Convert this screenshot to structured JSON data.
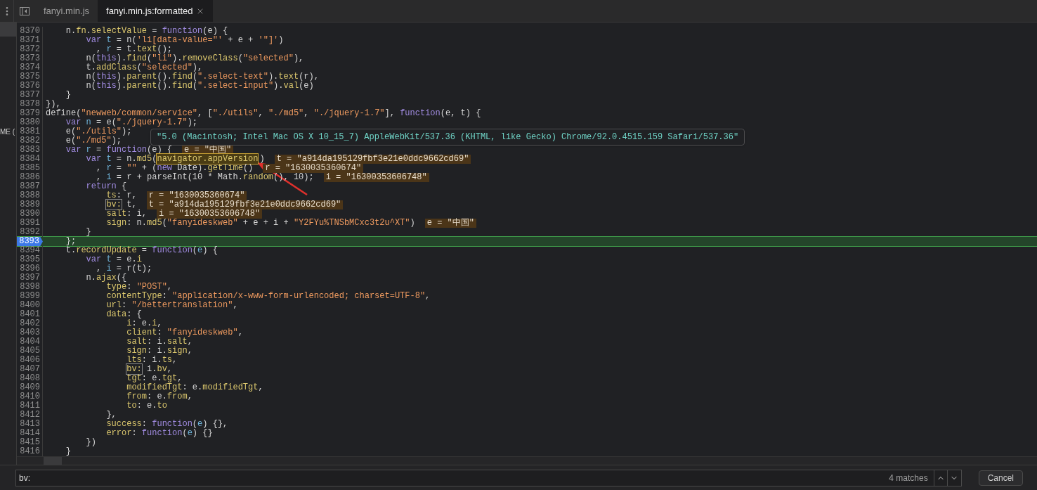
{
  "tabs": [
    {
      "label": "fanyi.min.js",
      "selected": false,
      "closable": false
    },
    {
      "label": "fanyi.min.js:formatted",
      "selected": true,
      "closable": true
    }
  ],
  "side_panel": {
    "text": "ME ("
  },
  "editor": {
    "tooltip": "\"5.0 (Macintosh; Intel Mac OS X 10_15_7) AppleWebKit/537.36 (KHTML, like Gecko) Chrome/92.0.4515.159 Safari/537.36\"",
    "lines": [
      {
        "number": "8370",
        "current": false,
        "tokens": [
          {
            "kind": "plain",
            "text": "    n."
          },
          {
            "kind": "property",
            "text": "fn"
          },
          {
            "kind": "plain",
            "text": "."
          },
          {
            "kind": "property",
            "text": "selectValue"
          },
          {
            "kind": "plain",
            "text": " = "
          },
          {
            "kind": "keyword",
            "text": "function"
          },
          {
            "kind": "plain",
            "text": "(e) {"
          }
        ]
      },
      {
        "number": "8371",
        "current": false,
        "tokens": [
          {
            "kind": "keyword",
            "text": "        var"
          },
          {
            "kind": "variable",
            "text": " t"
          },
          {
            "kind": "plain",
            "text": " = n("
          },
          {
            "kind": "string",
            "text": "'li[data-value=\"'"
          },
          {
            "kind": "plain",
            "text": " + e + "
          },
          {
            "kind": "string",
            "text": "'\"]'"
          },
          {
            "kind": "plain",
            "text": ")"
          }
        ]
      },
      {
        "number": "8372",
        "current": false,
        "tokens": [
          {
            "kind": "plain",
            "text": "          , "
          },
          {
            "kind": "variable",
            "text": "r"
          },
          {
            "kind": "plain",
            "text": " = t."
          },
          {
            "kind": "property",
            "text": "text"
          },
          {
            "kind": "plain",
            "text": "();"
          }
        ]
      },
      {
        "number": "8373",
        "current": false,
        "tokens": [
          {
            "kind": "plain",
            "text": "        n("
          },
          {
            "kind": "keyword",
            "text": "this"
          },
          {
            "kind": "plain",
            "text": ")."
          },
          {
            "kind": "property",
            "text": "find"
          },
          {
            "kind": "plain",
            "text": "("
          },
          {
            "kind": "string",
            "text": "\"li\""
          },
          {
            "kind": "plain",
            "text": ")."
          },
          {
            "kind": "property",
            "text": "removeClass"
          },
          {
            "kind": "plain",
            "text": "("
          },
          {
            "kind": "string",
            "text": "\"selected\""
          },
          {
            "kind": "plain",
            "text": "),"
          }
        ]
      },
      {
        "number": "8374",
        "current": false,
        "tokens": [
          {
            "kind": "plain",
            "text": "        t."
          },
          {
            "kind": "property",
            "text": "addClass"
          },
          {
            "kind": "plain",
            "text": "("
          },
          {
            "kind": "string",
            "text": "\"selected\""
          },
          {
            "kind": "plain",
            "text": "),"
          }
        ]
      },
      {
        "number": "8375",
        "current": false,
        "tokens": [
          {
            "kind": "plain",
            "text": "        n("
          },
          {
            "kind": "keyword",
            "text": "this"
          },
          {
            "kind": "plain",
            "text": ")."
          },
          {
            "kind": "property",
            "text": "parent"
          },
          {
            "kind": "plain",
            "text": "()."
          },
          {
            "kind": "property",
            "text": "find"
          },
          {
            "kind": "plain",
            "text": "("
          },
          {
            "kind": "string",
            "text": "\".select-text\""
          },
          {
            "kind": "plain",
            "text": ")."
          },
          {
            "kind": "property",
            "text": "text"
          },
          {
            "kind": "plain",
            "text": "(r),"
          }
        ]
      },
      {
        "number": "8376",
        "current": false,
        "tokens": [
          {
            "kind": "plain",
            "text": "        n("
          },
          {
            "kind": "keyword",
            "text": "this"
          },
          {
            "kind": "plain",
            "text": ")."
          },
          {
            "kind": "property",
            "text": "parent"
          },
          {
            "kind": "plain",
            "text": "()."
          },
          {
            "kind": "property",
            "text": "find"
          },
          {
            "kind": "plain",
            "text": "("
          },
          {
            "kind": "string",
            "text": "\".select-input\""
          },
          {
            "kind": "plain",
            "text": ")."
          },
          {
            "kind": "property",
            "text": "val"
          },
          {
            "kind": "plain",
            "text": "(e)"
          }
        ]
      },
      {
        "number": "8377",
        "current": false,
        "tokens": [
          {
            "kind": "plain",
            "text": "    }"
          }
        ]
      },
      {
        "number": "8378",
        "current": false,
        "tokens": [
          {
            "kind": "plain",
            "text": "}),"
          }
        ]
      },
      {
        "number": "8379",
        "current": false,
        "tokens": [
          {
            "kind": "plain",
            "text": "define("
          },
          {
            "kind": "string",
            "text": "\"newweb/common/service\""
          },
          {
            "kind": "plain",
            "text": ", ["
          },
          {
            "kind": "string",
            "text": "\"./utils\""
          },
          {
            "kind": "plain",
            "text": ", "
          },
          {
            "kind": "string",
            "text": "\"./md5\""
          },
          {
            "kind": "plain",
            "text": ", "
          },
          {
            "kind": "string",
            "text": "\"./jquery-1.7\""
          },
          {
            "kind": "plain",
            "text": "], "
          },
          {
            "kind": "keyword",
            "text": "function"
          },
          {
            "kind": "plain",
            "text": "(e, t) {"
          }
        ]
      },
      {
        "number": "8380",
        "current": false,
        "tokens": [
          {
            "kind": "keyword",
            "text": "    var"
          },
          {
            "kind": "variable",
            "text": " n"
          },
          {
            "kind": "plain",
            "text": " = e("
          },
          {
            "kind": "string",
            "text": "\"./jquery-1.7\""
          },
          {
            "kind": "plain",
            "text": ");"
          }
        ]
      },
      {
        "number": "8381",
        "current": false,
        "tokens": [
          {
            "kind": "plain",
            "text": "    e("
          },
          {
            "kind": "string",
            "text": "\"./utils\""
          },
          {
            "kind": "plain",
            "text": ");"
          }
        ]
      },
      {
        "number": "8382",
        "current": false,
        "tokens": [
          {
            "kind": "plain",
            "text": "    e("
          },
          {
            "kind": "string",
            "text": "\"./md5\""
          },
          {
            "kind": "plain",
            "text": ");"
          }
        ]
      },
      {
        "number": "8383",
        "current": false,
        "tokens": [
          {
            "kind": "keyword",
            "text": "    var"
          },
          {
            "kind": "variable",
            "text": " r"
          },
          {
            "kind": "plain",
            "text": " = "
          },
          {
            "kind": "keyword",
            "text": "function"
          },
          {
            "kind": "plain",
            "text": "(e) {"
          }
        ],
        "value": "e = \"中国\""
      },
      {
        "number": "8384",
        "current": false,
        "tokens": [
          {
            "kind": "keyword",
            "text": "        var"
          },
          {
            "kind": "variable",
            "text": " t"
          },
          {
            "kind": "plain",
            "text": " = n."
          },
          {
            "kind": "property",
            "text": "md5"
          },
          {
            "kind": "plain",
            "text": "("
          },
          {
            "kind": "highlight",
            "text": "navigator.appVersion"
          },
          {
            "kind": "plain",
            "text": ")"
          }
        ],
        "value": "t = \"a914da195129fbf3e21e0ddc9662cd69\""
      },
      {
        "number": "8385",
        "current": false,
        "tokens": [
          {
            "kind": "plain",
            "text": "          , "
          },
          {
            "kind": "variable",
            "text": "r"
          },
          {
            "kind": "plain",
            "text": " = "
          },
          {
            "kind": "string",
            "text": "\"\""
          },
          {
            "kind": "plain",
            "text": " + ("
          },
          {
            "kind": "keyword",
            "text": "new"
          },
          {
            "kind": "plain",
            "text": " Date)."
          },
          {
            "kind": "property",
            "text": "getTime"
          },
          {
            "kind": "plain",
            "text": "()"
          }
        ],
        "value": "r = \"1630035360674\""
      },
      {
        "number": "8386",
        "current": false,
        "tokens": [
          {
            "kind": "plain",
            "text": "          , "
          },
          {
            "kind": "variable",
            "text": "i"
          },
          {
            "kind": "plain",
            "text": " = r + parseInt(10 * Math."
          },
          {
            "kind": "property",
            "text": "random"
          },
          {
            "kind": "plain",
            "text": "(), 10);"
          }
        ],
        "value": "i = \"16300353606748\""
      },
      {
        "number": "8387",
        "current": false,
        "tokens": [
          {
            "kind": "keyword",
            "text": "        return"
          },
          {
            "kind": "plain",
            "text": " {"
          }
        ]
      },
      {
        "number": "8388",
        "current": false,
        "tokens": [
          {
            "kind": "property",
            "text": "            ts"
          },
          {
            "kind": "plain",
            "text": ": r,"
          }
        ],
        "value": "r = \"1630035360674\""
      },
      {
        "number": "8389",
        "current": false,
        "tokens": [
          {
            "kind": "boxed",
            "text": "            bv:"
          },
          {
            "kind": "plain",
            "text": " t,"
          }
        ],
        "value": "t = \"a914da195129fbf3e21e0ddc9662cd69\""
      },
      {
        "number": "8390",
        "current": false,
        "tokens": [
          {
            "kind": "property",
            "text": "            salt"
          },
          {
            "kind": "plain",
            "text": ": i,"
          }
        ],
        "value": "i = \"16300353606748\""
      },
      {
        "number": "8391",
        "current": false,
        "tokens": [
          {
            "kind": "property",
            "text": "            sign"
          },
          {
            "kind": "plain",
            "text": ": n."
          },
          {
            "kind": "property",
            "text": "md5"
          },
          {
            "kind": "plain",
            "text": "("
          },
          {
            "kind": "string",
            "text": "\"fanyideskweb\""
          },
          {
            "kind": "plain",
            "text": " + e + i + "
          },
          {
            "kind": "string",
            "text": "\"Y2FYu%TNSbMCxc3t2u^XT\""
          },
          {
            "kind": "plain",
            "text": ")"
          }
        ],
        "value": "e = \"中国\""
      },
      {
        "number": "8392",
        "current": false,
        "tokens": [
          {
            "kind": "plain",
            "text": "        }"
          }
        ]
      },
      {
        "number": "8393",
        "current": true,
        "tokens": [
          {
            "kind": "plain",
            "text": "    };"
          }
        ]
      },
      {
        "number": "8394",
        "current": false,
        "tokens": [
          {
            "kind": "plain",
            "text": "    t."
          },
          {
            "kind": "property",
            "text": "recordUpdate"
          },
          {
            "kind": "plain",
            "text": " = "
          },
          {
            "kind": "keyword",
            "text": "function"
          },
          {
            "kind": "plain",
            "text": "("
          },
          {
            "kind": "variable",
            "text": "e"
          },
          {
            "kind": "plain",
            "text": ") {"
          }
        ]
      },
      {
        "number": "8395",
        "current": false,
        "tokens": [
          {
            "kind": "keyword",
            "text": "        var"
          },
          {
            "kind": "variable",
            "text": " t"
          },
          {
            "kind": "plain",
            "text": " = e."
          },
          {
            "kind": "property",
            "text": "i"
          }
        ]
      },
      {
        "number": "8396",
        "current": false,
        "tokens": [
          {
            "kind": "plain",
            "text": "          , "
          },
          {
            "kind": "variable",
            "text": "i"
          },
          {
            "kind": "plain",
            "text": " = r(t);"
          }
        ]
      },
      {
        "number": "8397",
        "current": false,
        "tokens": [
          {
            "kind": "plain",
            "text": "        n."
          },
          {
            "kind": "property",
            "text": "ajax"
          },
          {
            "kind": "plain",
            "text": "({"
          }
        ]
      },
      {
        "number": "8398",
        "current": false,
        "tokens": [
          {
            "kind": "property",
            "text": "            type"
          },
          {
            "kind": "plain",
            "text": ": "
          },
          {
            "kind": "string",
            "text": "\"POST\""
          },
          {
            "kind": "plain",
            "text": ","
          }
        ]
      },
      {
        "number": "8399",
        "current": false,
        "tokens": [
          {
            "kind": "property",
            "text": "            contentType"
          },
          {
            "kind": "plain",
            "text": ": "
          },
          {
            "kind": "string",
            "text": "\"application/x-www-form-urlencoded; charset=UTF-8\""
          },
          {
            "kind": "plain",
            "text": ","
          }
        ]
      },
      {
        "number": "8400",
        "current": false,
        "tokens": [
          {
            "kind": "property",
            "text": "            url"
          },
          {
            "kind": "plain",
            "text": ": "
          },
          {
            "kind": "string",
            "text": "\"/bettertranslation\""
          },
          {
            "kind": "plain",
            "text": ","
          }
        ]
      },
      {
        "number": "8401",
        "current": false,
        "tokens": [
          {
            "kind": "property",
            "text": "            data"
          },
          {
            "kind": "plain",
            "text": ": {"
          }
        ]
      },
      {
        "number": "8402",
        "current": false,
        "tokens": [
          {
            "kind": "property",
            "text": "                i"
          },
          {
            "kind": "plain",
            "text": ": e."
          },
          {
            "kind": "property",
            "text": "i"
          },
          {
            "kind": "plain",
            "text": ","
          }
        ]
      },
      {
        "number": "8403",
        "current": false,
        "tokens": [
          {
            "kind": "property",
            "text": "                client"
          },
          {
            "kind": "plain",
            "text": ": "
          },
          {
            "kind": "string",
            "text": "\"fanyideskweb\""
          },
          {
            "kind": "plain",
            "text": ","
          }
        ]
      },
      {
        "number": "8404",
        "current": false,
        "tokens": [
          {
            "kind": "property",
            "text": "                salt"
          },
          {
            "kind": "plain",
            "text": ": i."
          },
          {
            "kind": "property",
            "text": "salt"
          },
          {
            "kind": "plain",
            "text": ","
          }
        ]
      },
      {
        "number": "8405",
        "current": false,
        "tokens": [
          {
            "kind": "property",
            "text": "                sign"
          },
          {
            "kind": "plain",
            "text": ": i."
          },
          {
            "kind": "property",
            "text": "sign"
          },
          {
            "kind": "plain",
            "text": ","
          }
        ]
      },
      {
        "number": "8406",
        "current": false,
        "tokens": [
          {
            "kind": "property",
            "text": "                lts"
          },
          {
            "kind": "plain",
            "text": ": i."
          },
          {
            "kind": "property",
            "text": "ts"
          },
          {
            "kind": "plain",
            "text": ","
          }
        ]
      },
      {
        "number": "8407",
        "current": false,
        "tokens": [
          {
            "kind": "boxed",
            "text": "                bv:"
          },
          {
            "kind": "plain",
            "text": " i."
          },
          {
            "kind": "property",
            "text": "bv"
          },
          {
            "kind": "plain",
            "text": ","
          }
        ]
      },
      {
        "number": "8408",
        "current": false,
        "tokens": [
          {
            "kind": "property",
            "text": "                tgt"
          },
          {
            "kind": "plain",
            "text": ": e."
          },
          {
            "kind": "property",
            "text": "tgt"
          },
          {
            "kind": "plain",
            "text": ","
          }
        ]
      },
      {
        "number": "8409",
        "current": false,
        "tokens": [
          {
            "kind": "property",
            "text": "                modifiedTgt"
          },
          {
            "kind": "plain",
            "text": ": e."
          },
          {
            "kind": "property",
            "text": "modifiedTgt"
          },
          {
            "kind": "plain",
            "text": ","
          }
        ]
      },
      {
        "number": "8410",
        "current": false,
        "tokens": [
          {
            "kind": "property",
            "text": "                from"
          },
          {
            "kind": "plain",
            "text": ": e."
          },
          {
            "kind": "property",
            "text": "from"
          },
          {
            "kind": "plain",
            "text": ","
          }
        ]
      },
      {
        "number": "8411",
        "current": false,
        "tokens": [
          {
            "kind": "property",
            "text": "                to"
          },
          {
            "kind": "plain",
            "text": ": e."
          },
          {
            "kind": "property",
            "text": "to"
          }
        ]
      },
      {
        "number": "8412",
        "current": false,
        "tokens": [
          {
            "kind": "plain",
            "text": "            },"
          }
        ]
      },
      {
        "number": "8413",
        "current": false,
        "tokens": [
          {
            "kind": "property",
            "text": "            success"
          },
          {
            "kind": "plain",
            "text": ": "
          },
          {
            "kind": "keyword",
            "text": "function"
          },
          {
            "kind": "plain",
            "text": "("
          },
          {
            "kind": "variable",
            "text": "e"
          },
          {
            "kind": "plain",
            "text": ") {},"
          }
        ]
      },
      {
        "number": "8414",
        "current": false,
        "tokens": [
          {
            "kind": "property",
            "text": "            error"
          },
          {
            "kind": "plain",
            "text": ": "
          },
          {
            "kind": "keyword",
            "text": "function"
          },
          {
            "kind": "plain",
            "text": "("
          },
          {
            "kind": "variable",
            "text": "e"
          },
          {
            "kind": "plain",
            "text": ") {}"
          }
        ]
      },
      {
        "number": "8415",
        "current": false,
        "tokens": [
          {
            "kind": "plain",
            "text": "        })"
          }
        ]
      },
      {
        "number": "8416",
        "current": false,
        "tokens": [
          {
            "kind": "plain",
            "text": "    }"
          }
        ]
      }
    ]
  },
  "search": {
    "value": "bv:",
    "matches": "4 matches",
    "cancel": "Cancel"
  }
}
